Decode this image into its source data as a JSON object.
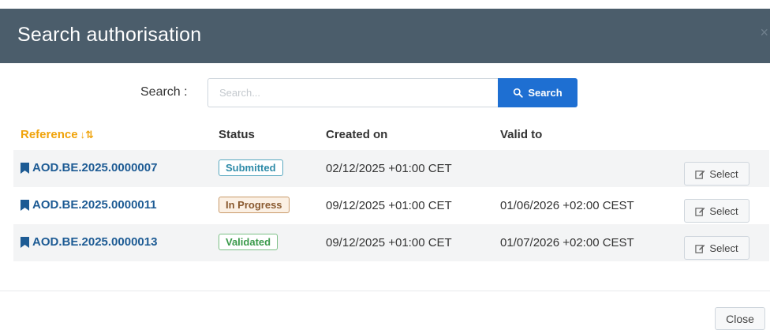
{
  "dialog": {
    "title": "Search authorisation",
    "close_icon": "close-icon"
  },
  "search": {
    "label": "Search :",
    "placeholder": "Search...",
    "value": "",
    "button_label": "Search",
    "button_icon": "search-icon"
  },
  "table": {
    "headers": {
      "reference": "Reference",
      "status": "Status",
      "created_on": "Created on",
      "valid_to": "Valid to"
    },
    "sort_icon": "sort-icon",
    "rows": [
      {
        "reference": "AOD.BE.2025.0000007",
        "status": "Submitted",
        "created_on": "02/12/2025 +01:00 CET",
        "valid_to": "",
        "select_label": "Select"
      },
      {
        "reference": "AOD.BE.2025.0000011",
        "status": "In Progress",
        "created_on": "09/12/2025 +01:00 CET",
        "valid_to": "01/06/2026 +02:00 CEST",
        "select_label": "Select"
      },
      {
        "reference": "AOD.BE.2025.0000013",
        "status": "Validated",
        "created_on": "09/12/2025 +01:00 CET",
        "valid_to": "01/07/2026 +02:00 CEST",
        "select_label": "Select"
      }
    ]
  },
  "footer": {
    "close_label": "Close"
  },
  "colors": {
    "header_bg": "#4b5d6b",
    "primary": "#1e6fd2",
    "reference_link": "#1d5b94",
    "sorted_header": "#f0a30a"
  }
}
